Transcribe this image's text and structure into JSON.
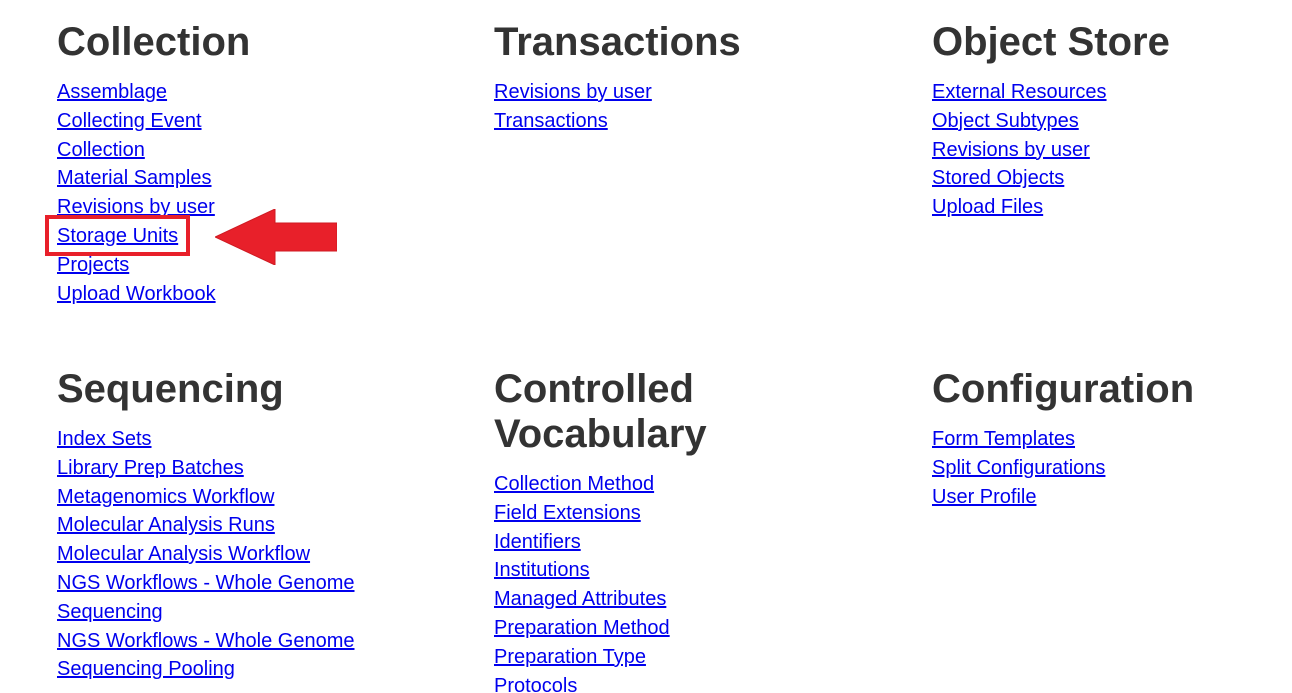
{
  "sections": {
    "collection": {
      "title": "Collection",
      "links": [
        "Assemblage",
        "Collecting Event",
        "Collection",
        "Material Samples",
        "Revisions by user",
        "Storage Units",
        "Projects",
        "Upload Workbook"
      ]
    },
    "transactions": {
      "title": "Transactions",
      "links": [
        "Revisions by user",
        "Transactions"
      ]
    },
    "object_store": {
      "title": "Object Store",
      "links": [
        "External Resources",
        "Object Subtypes",
        "Revisions by user",
        "Stored Objects",
        "Upload Files"
      ]
    },
    "sequencing": {
      "title": "Sequencing",
      "links": [
        "Index Sets",
        "Library Prep Batches",
        "Metagenomics Workflow",
        "Molecular Analysis Runs",
        "Molecular Analysis Workflow",
        "NGS Workflows - Whole Genome Sequencing",
        "NGS Workflows - Whole Genome Sequencing Pooling"
      ]
    },
    "controlled_vocabulary": {
      "title": "Controlled Vocabulary",
      "links": [
        "Collection Method",
        "Field Extensions",
        "Identifiers",
        "Institutions",
        "Managed Attributes",
        "Preparation Method",
        "Preparation Type",
        "Protocols"
      ]
    },
    "configuration": {
      "title": "Configuration",
      "links": [
        "Form Templates",
        "Split Configurations",
        "User Profile"
      ]
    }
  },
  "annotation": {
    "highlight_color": "#e8202a",
    "arrow_icon": "left-arrow-icon",
    "highlighted_link": "Storage Units"
  }
}
